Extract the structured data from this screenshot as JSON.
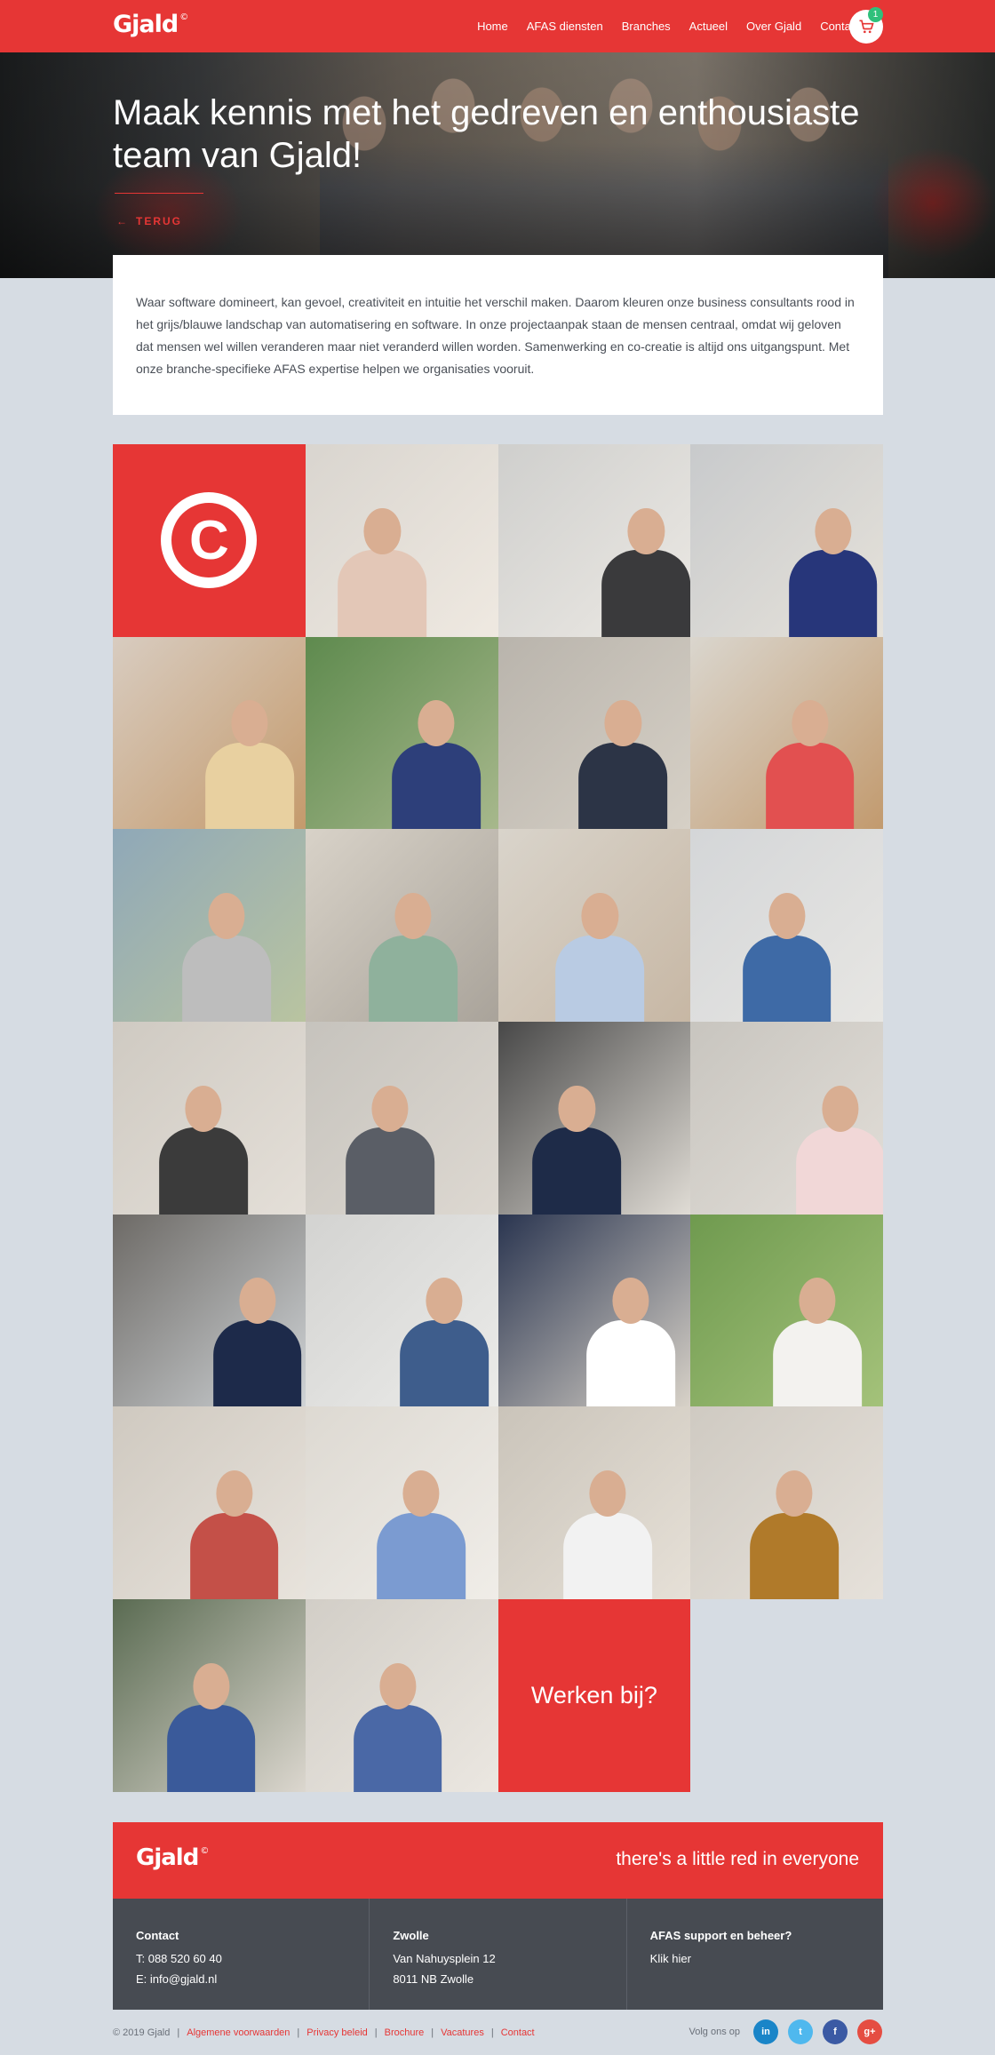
{
  "header": {
    "logo": "Gjald",
    "nav": [
      "Home",
      "AFAS diensten",
      "Branches",
      "Actueel",
      "Over Gjald",
      "Contact"
    ],
    "cart_count": "1"
  },
  "hero": {
    "title": "Maak kennis met het gedreven en enthousiaste team van Gjald!",
    "back_label": "TERUG"
  },
  "intro": {
    "text": "Waar software domineert, kan gevoel, creativiteit en intuitie het verschil maken. Daarom kleuren onze business consultants rood in het grijs/blauwe landschap van automatisering en software. In onze projectaanpak staan de mensen centraal, omdat wij geloven dat mensen wel willen veranderen maar niet veranderd willen worden.  Samenwerking en co-creatie is altijd ons uitgangspunt. Met onze branche-specifieke AFAS expertise helpen we organisaties vooruit."
  },
  "grid": {
    "logo_mark": "C",
    "photo_count": 25,
    "work_label": "Werken bij?"
  },
  "footer": {
    "logo": "Gjald",
    "tagline": "there's a little red in everyone",
    "columns": [
      {
        "title": "Contact",
        "lines": [
          "T: 088 520 60 40",
          "E: info@gjald.nl"
        ]
      },
      {
        "title": "Zwolle",
        "lines": [
          "Van Nahuysplein 12",
          "8011 NB Zwolle"
        ]
      },
      {
        "title": "AFAS support en beheer?",
        "lines": [
          "Klik hier",
          ""
        ]
      }
    ],
    "copyright": "© 2019 Gjald",
    "links": [
      "Algemene voorwaarden",
      "Privacy beleid",
      "Brochure",
      "Vacatures",
      "Contact"
    ],
    "social_label": "Volg ons op",
    "social": [
      {
        "name": "linkedin-icon",
        "glyph": "in",
        "color": "#1a85c8"
      },
      {
        "name": "twitter-icon",
        "glyph": "t",
        "color": "#4fb8ee"
      },
      {
        "name": "facebook-icon",
        "glyph": "f",
        "color": "#3b5aa4"
      },
      {
        "name": "googleplus-icon",
        "glyph": "g+",
        "color": "#e54d42"
      }
    ]
  },
  "colors": {
    "brand_red": "#e63635",
    "footer_dark": "#474b52",
    "page_bg": "#d6dce3"
  }
}
